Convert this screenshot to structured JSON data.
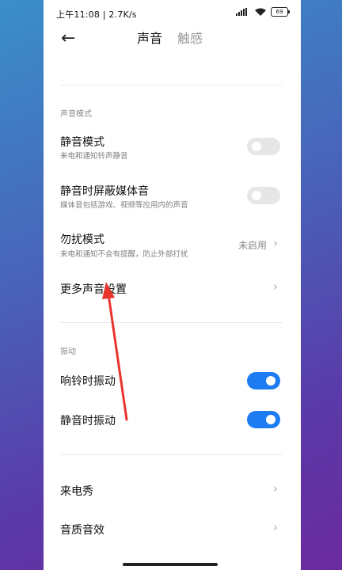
{
  "status_bar": {
    "time_speed": "上午11:08 | 2.7K/s",
    "battery": "69"
  },
  "header": {
    "tab_sound": "声音",
    "tab_haptics": "触感"
  },
  "sound_mode": {
    "section": "声音模式",
    "silent_mode": {
      "title": "静音模式",
      "subtitle": "来电和通知铃声静音",
      "enabled": false
    },
    "mute_media": {
      "title": "静音时屏蔽媒体音",
      "subtitle": "媒体音包括游戏、视频等应用内的声音",
      "enabled": false
    },
    "dnd": {
      "title": "勿扰模式",
      "subtitle": "来电和通知不会有提醒，防止外部打扰",
      "value": "未启用"
    },
    "more_sound": {
      "title": "更多声音设置"
    }
  },
  "vibration": {
    "section": "振动",
    "ring_vibrate": {
      "title": "响铃时振动",
      "enabled": true
    },
    "silent_vibrate": {
      "title": "静音时振动",
      "enabled": true
    }
  },
  "other": {
    "caller_show": {
      "title": "来电秀"
    },
    "sound_quality": {
      "title": "音质音效"
    }
  },
  "colors": {
    "accent": "#1d7cf2",
    "annotation_arrow": "#e8342a"
  }
}
